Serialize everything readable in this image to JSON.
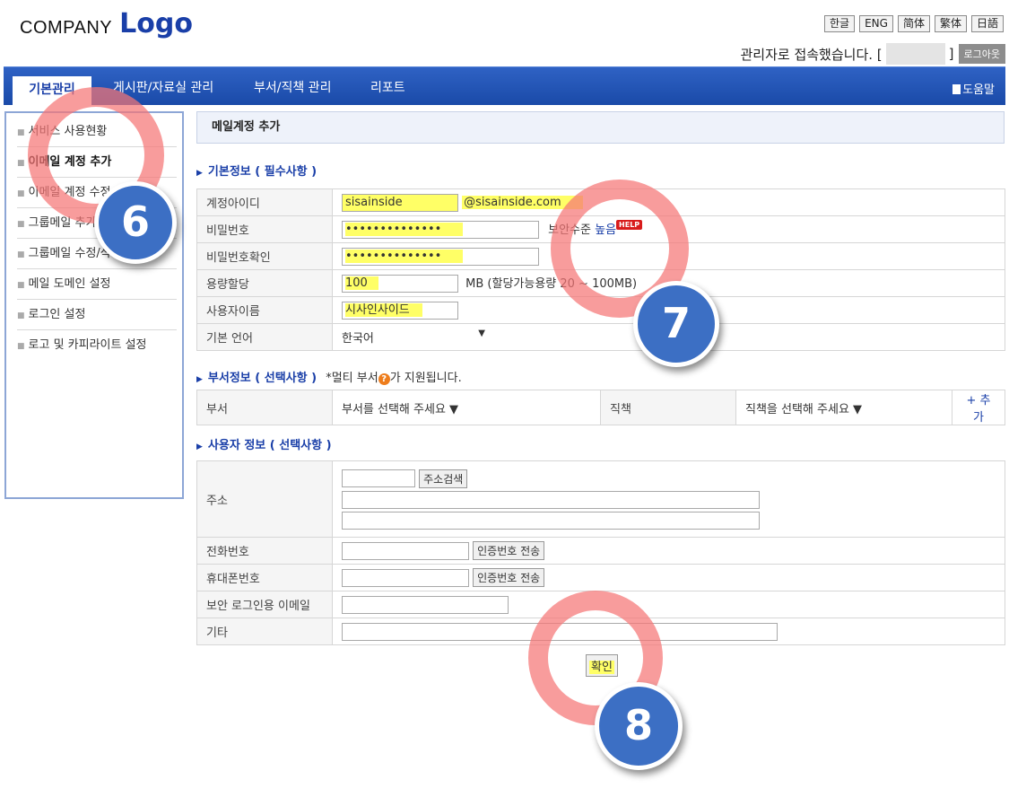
{
  "header": {
    "company": "COMPANY",
    "logo": "Logo",
    "languages": [
      "한글",
      "ENG",
      "简体",
      "繁体",
      "日語"
    ],
    "login_text": "관리자로 접속했습니다. [",
    "login_bracket_close": "]",
    "logout_label": "로그아웃"
  },
  "nav": {
    "tabs": [
      "기본관리",
      "게시판/자료실 관리",
      "부서/직책 관리",
      "리포트"
    ],
    "help_label": "도움말"
  },
  "sidebar": {
    "items": [
      "서비스 사용현황",
      "이메일 계정 추가",
      "이메일 계정 수정",
      "그룹메일 추가",
      "그룹메일 수정/삭제",
      "메일 도메인 설정",
      "로그인 설정",
      "로고 및 카피라이트 설정"
    ]
  },
  "page_title": "메일계정 추가",
  "basic": {
    "section_label": "기본정보 ( 필수사항 )",
    "labels": [
      "계정아이디",
      "비밀번호",
      "비밀번호확인",
      "용량할당",
      "사용자이름",
      "기본 언어"
    ],
    "account_id": "sisainside",
    "domain": "@sisainside.com",
    "password": "••••••••••••••",
    "password_confirm": "••••••••••••••",
    "security_label": "보안수준",
    "security_value": "높음",
    "help_badge": "HELP",
    "quota": "100",
    "quota_note": "MB (할당가능용량 20 ~ 100MB)",
    "username": "시사인사이드",
    "language": "한국어"
  },
  "dept": {
    "section_label": "부서정보 ( 선택사항 )",
    "note_prefix": "*멀티 부서",
    "note_suffix": "가 지원됩니다.",
    "dept_label": "부서",
    "dept_select": "부서를 선택해 주세요 ▼",
    "position_label": "직책",
    "position_select": "직책을 선택해 주세요 ▼",
    "add_label": "+ 추가"
  },
  "user": {
    "section_label": "사용자 정보 ( 선택사항 )",
    "address_label": "주소",
    "address_search": "주소검색",
    "phone_label": "전화번호",
    "mobile_label": "휴대폰번호",
    "verify_button": "인증번호 전송",
    "secure_email_label": "보안 로그인용 이메일",
    "etc_label": "기타"
  },
  "confirm_label": "확인",
  "annotations": [
    "6",
    "7",
    "8"
  ],
  "colors": {
    "nav": "#1a4aa8",
    "accent": "#1a3fa8",
    "highlight": "#ffff66",
    "ring": "#f57676",
    "badge": "#3c6fc4"
  }
}
